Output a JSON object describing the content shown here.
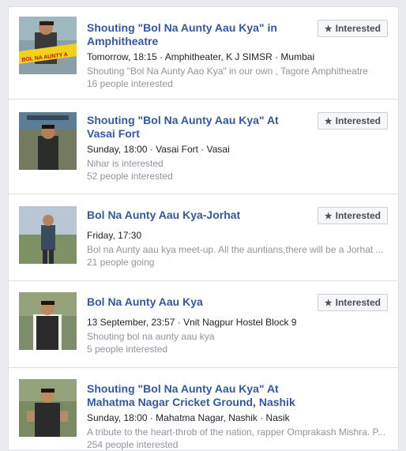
{
  "events": [
    {
      "title": "Shouting \"Bol Na Aunty Aau Kya\" in Amphitheatre",
      "meta": "Tomorrow, 18:15 · Amphitheater, K J SIMSR · Mumbai",
      "description": "Shouting \"Bol Na Aunty Aao Kya\" in our own , Tagore Amphitheatre",
      "extra": "",
      "count": "16 people interested",
      "button": "Interested",
      "thumb_text": "BOL NA AUNTY A"
    },
    {
      "title": "Shouting \"Bol Na Aunty Aau Kya\" At Vasai Fort",
      "meta": "Sunday, 18:00 · Vasai Fort · Vasai",
      "description": "Nihar is interested",
      "extra": "",
      "count": "52 people interested",
      "button": "Interested",
      "thumb_text": ""
    },
    {
      "title": "Bol Na Aunty Aau Kya-Jorhat",
      "meta": "Friday, 17:30",
      "description": "Bol na Aunty aau kya meet-up. All the auntians,there will be a Jorhat ...",
      "extra": "",
      "count": "21 people going",
      "button": "Interested",
      "thumb_text": ""
    },
    {
      "title": "Bol Na Aunty Aau Kya",
      "meta": "13 September, 23:57 · Vnit Nagpur Hostel Block 9",
      "description": "Shouting bol na aunty aau kya",
      "extra": "",
      "count": "5 people interested",
      "button": "Interested",
      "thumb_text": ""
    },
    {
      "title": "Shouting \"Bol Na Aunty Aau Kya\" At Mahatma Nagar Cricket Ground, Nashik",
      "meta": "Sunday, 18:00 · Mahatma Nagar, Nashik · Nasik",
      "description": "A tribute to the heart-throb of the nation, rapper Omprakash Mishra. P...",
      "extra": "",
      "count": "254 people interested",
      "button": "",
      "thumb_text": ""
    }
  ],
  "icons": {
    "interested": "star-icon"
  },
  "colors": {
    "title": "#365899",
    "muted": "#90949c",
    "text": "#1d2129",
    "bg": "#e9ebee"
  }
}
